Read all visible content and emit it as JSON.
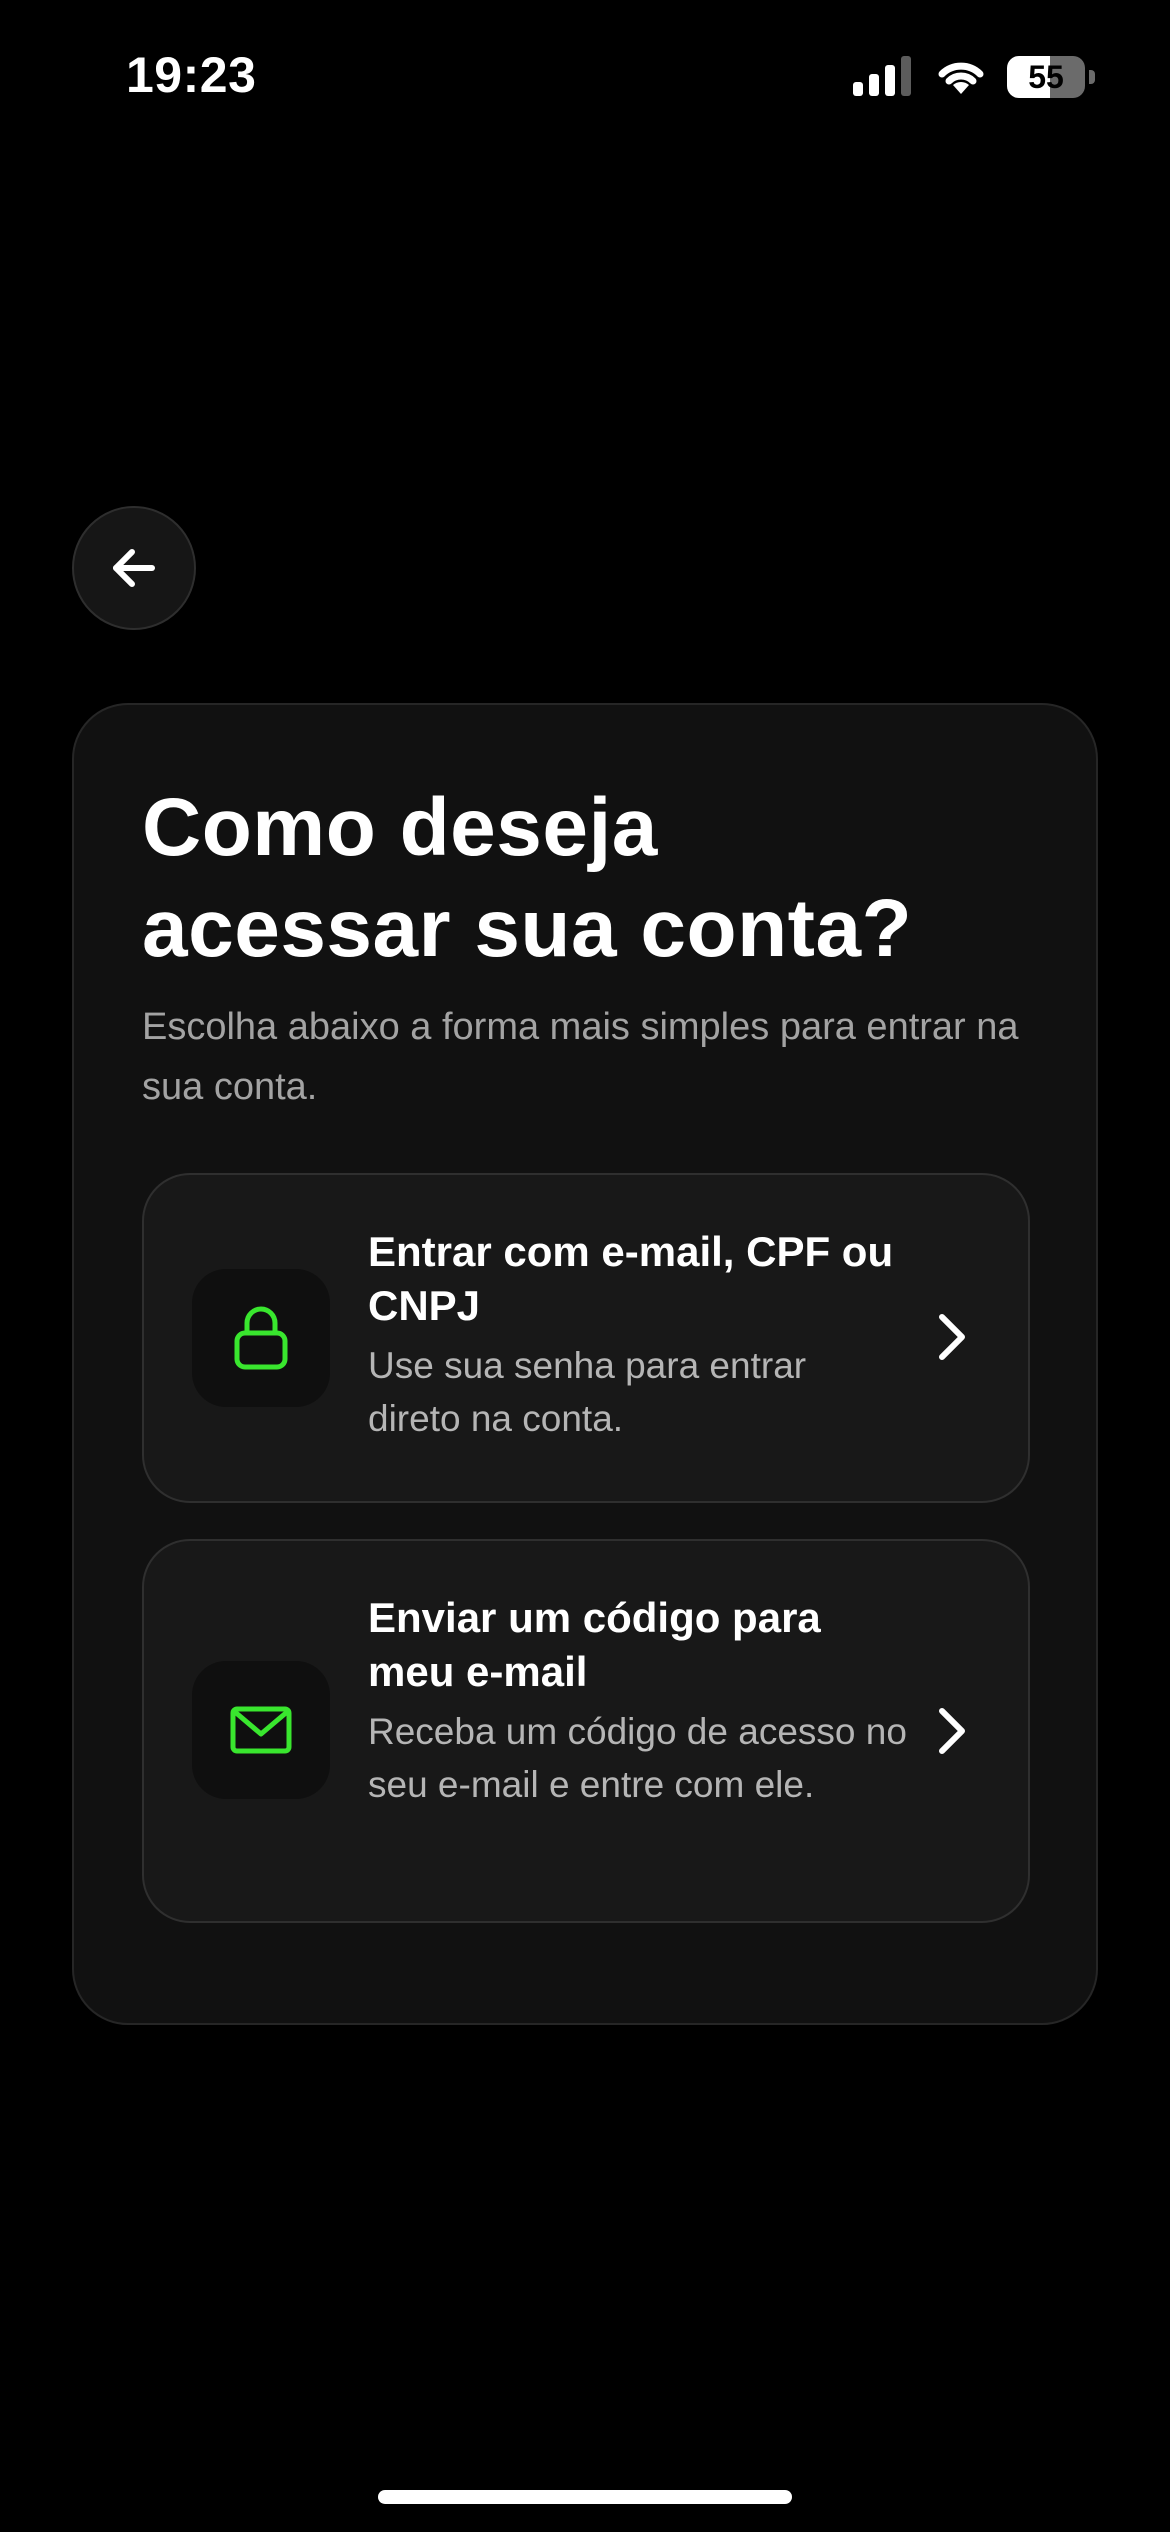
{
  "status_bar": {
    "time": "19:23",
    "battery_level": "55",
    "icons": [
      "signal-icon",
      "wifi-icon",
      "battery-icon"
    ]
  },
  "back_button": {
    "icon": "arrow-left-icon"
  },
  "card": {
    "title": "Como deseja\nacessar sua conta?",
    "subtitle": "Escolha abaixo a forma mais simples para entrar na sua conta.",
    "options": [
      {
        "icon": "lock-icon",
        "title": "Entrar com e-mail, CPF ou CNPJ",
        "description": "Use sua senha para entrar direto na conta."
      },
      {
        "icon": "mail-icon",
        "title": "Enviar um código para meu e-mail",
        "description": "Receba um código de acesso no seu e-mail e entre com ele."
      }
    ]
  },
  "colors": {
    "background": "#000000",
    "card": "#111111",
    "option": "#181818",
    "accent": "#39E62E",
    "text_secondary": "#A3A3A3"
  }
}
